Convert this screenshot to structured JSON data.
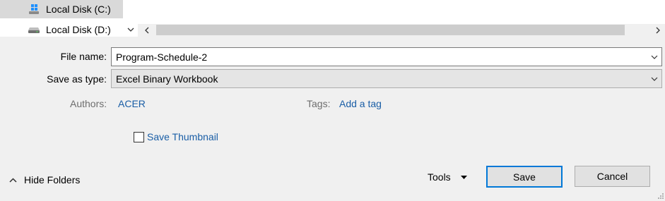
{
  "nav": {
    "items": [
      {
        "label": "Local Disk (C:)",
        "icon": "windows-drive-icon",
        "selected": true
      },
      {
        "label": "Local Disk (D:)",
        "icon": "drive-icon",
        "selected": false
      }
    ]
  },
  "form": {
    "file_name_label": "File name:",
    "file_name_value": "Program-Schedule-2",
    "save_type_label": "Save as type:",
    "save_type_value": "Excel Binary Workbook"
  },
  "meta": {
    "authors_label": "Authors:",
    "authors_value": "ACER",
    "tags_label": "Tags:",
    "tags_value": "Add a tag"
  },
  "thumbnail": {
    "label": "Save Thumbnail",
    "checked": false
  },
  "footer": {
    "hide_folders_label": "Hide Folders",
    "tools_label": "Tools",
    "save_label": "Save",
    "cancel_label": "Cancel"
  },
  "colors": {
    "accent": "#0078d7",
    "link": "#1a5ea6",
    "background": "#f0f0f0"
  }
}
